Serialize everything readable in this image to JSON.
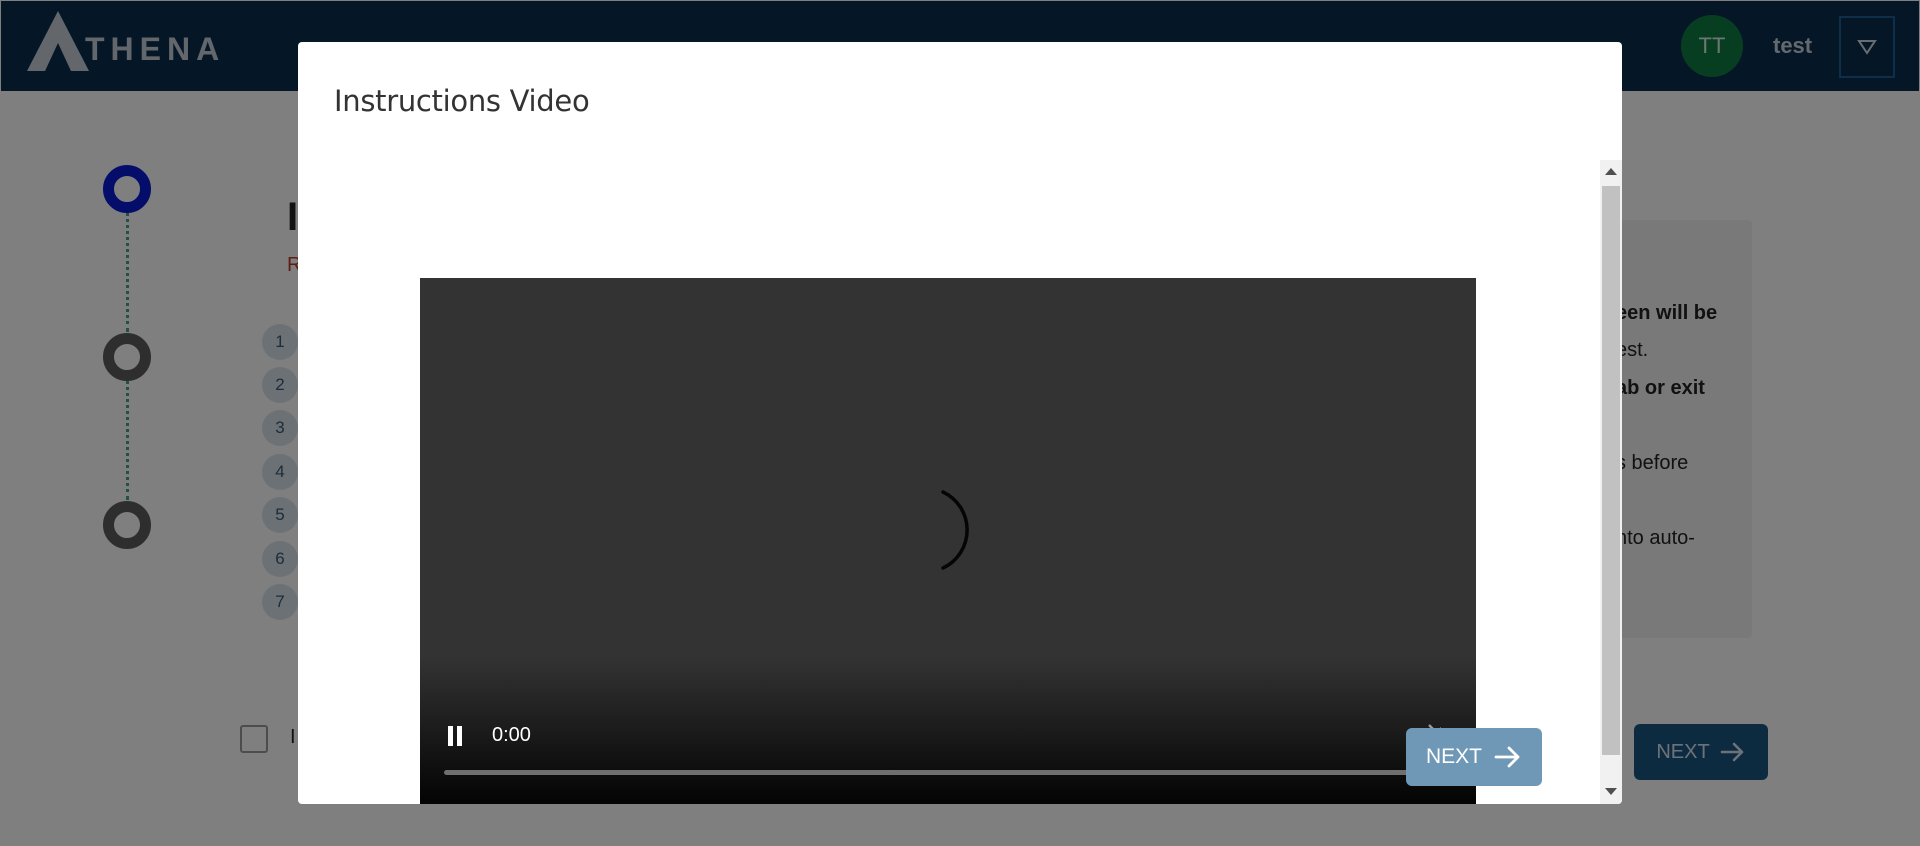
{
  "header": {
    "logo_text": "THENA",
    "avatar_initials": "TT",
    "username": "test"
  },
  "background": {
    "card_title": "I",
    "card_subtitle": "R",
    "numbers": [
      "1",
      "2",
      "3",
      "4",
      "5",
      "6",
      "7"
    ],
    "rules_fragments": [
      {
        "text": "een will be",
        "bold": true
      },
      {
        "text": "est.",
        "bold": false
      },
      {
        "text": "ab or exit",
        "bold": true
      },
      {
        "text": "s before",
        "bold": false
      },
      {
        "text": "nto auto-",
        "bold": false
      }
    ],
    "agree_label": "I",
    "next_label": "NEXT"
  },
  "modal": {
    "title": "Instructions Video",
    "video": {
      "time": "0:00",
      "state": "loading",
      "muted": true,
      "progress": 0
    },
    "next_label": "NEXT"
  },
  "colors": {
    "header_bg": "#0b2f4e",
    "avatar_bg": "#0f7a43",
    "step_active": "#0b1bd6",
    "modal_next_bg": "#6f98b6"
  }
}
